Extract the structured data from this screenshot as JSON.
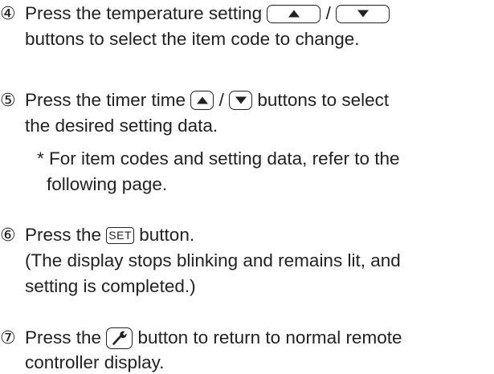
{
  "step4": {
    "number": "④",
    "line1_pre": "Press the temperature setting ",
    "slash": " / ",
    "line2": "buttons to select the item code to change."
  },
  "step5": {
    "number": "⑤",
    "line1_pre": "Press the timer time ",
    "slash": " / ",
    "line1_post": " buttons to select",
    "line2": "the desired setting data."
  },
  "note": {
    "line1": "* For item codes and setting data, refer to the",
    "line2": "following page."
  },
  "step6": {
    "number": "⑥",
    "line1_pre": "Press the ",
    "set_label": "SET",
    "line1_post": " button.",
    "line2": "(The display stops blinking and remains lit, and",
    "line3": "setting is completed.)"
  },
  "step7": {
    "number": "⑦",
    "line1_pre": "Press the ",
    "line1_post": " button to return to normal remote",
    "line2": "controller display."
  },
  "icons": {
    "up": "up-triangle-icon",
    "down": "down-triangle-icon",
    "wrench": "wrench-icon"
  }
}
